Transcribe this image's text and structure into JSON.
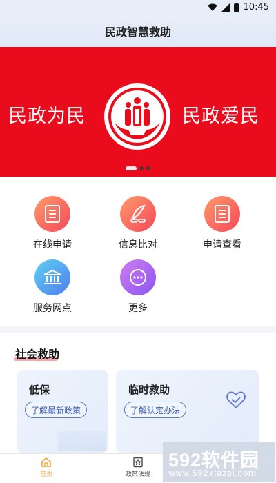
{
  "status_bar": {
    "time": "10:45"
  },
  "header": {
    "title": "民政智慧救助"
  },
  "banner": {
    "left_text": "民政为民",
    "right_text": "民政爱民",
    "emblem_icon": "civil-affairs-emblem",
    "page_count": 3,
    "active_index": 0
  },
  "services": [
    {
      "label": "在线申请",
      "icon": "document-icon"
    },
    {
      "label": "信息比对",
      "icon": "feather-icon"
    },
    {
      "label": "申请查看",
      "icon": "document-icon"
    },
    {
      "label": "服务网点",
      "icon": "bank-icon"
    },
    {
      "label": "更多",
      "icon": "more-icon"
    }
  ],
  "section": {
    "title": "社会救助"
  },
  "cards": [
    {
      "title": "低保",
      "button": "了解最新政策"
    },
    {
      "title": "临时救助",
      "button": "了解认定办法"
    }
  ],
  "tabs": [
    {
      "label": "首页",
      "icon": "home-icon"
    },
    {
      "label": "政策法规",
      "icon": "star-book-icon"
    }
  ],
  "watermark": {
    "brand": "592软件园",
    "url": "www.592xiazai.com"
  },
  "colors": {
    "banner_red": "#ea0b1c",
    "accent_orange": "#f3a53c",
    "card_button_blue": "#3f5fba"
  }
}
